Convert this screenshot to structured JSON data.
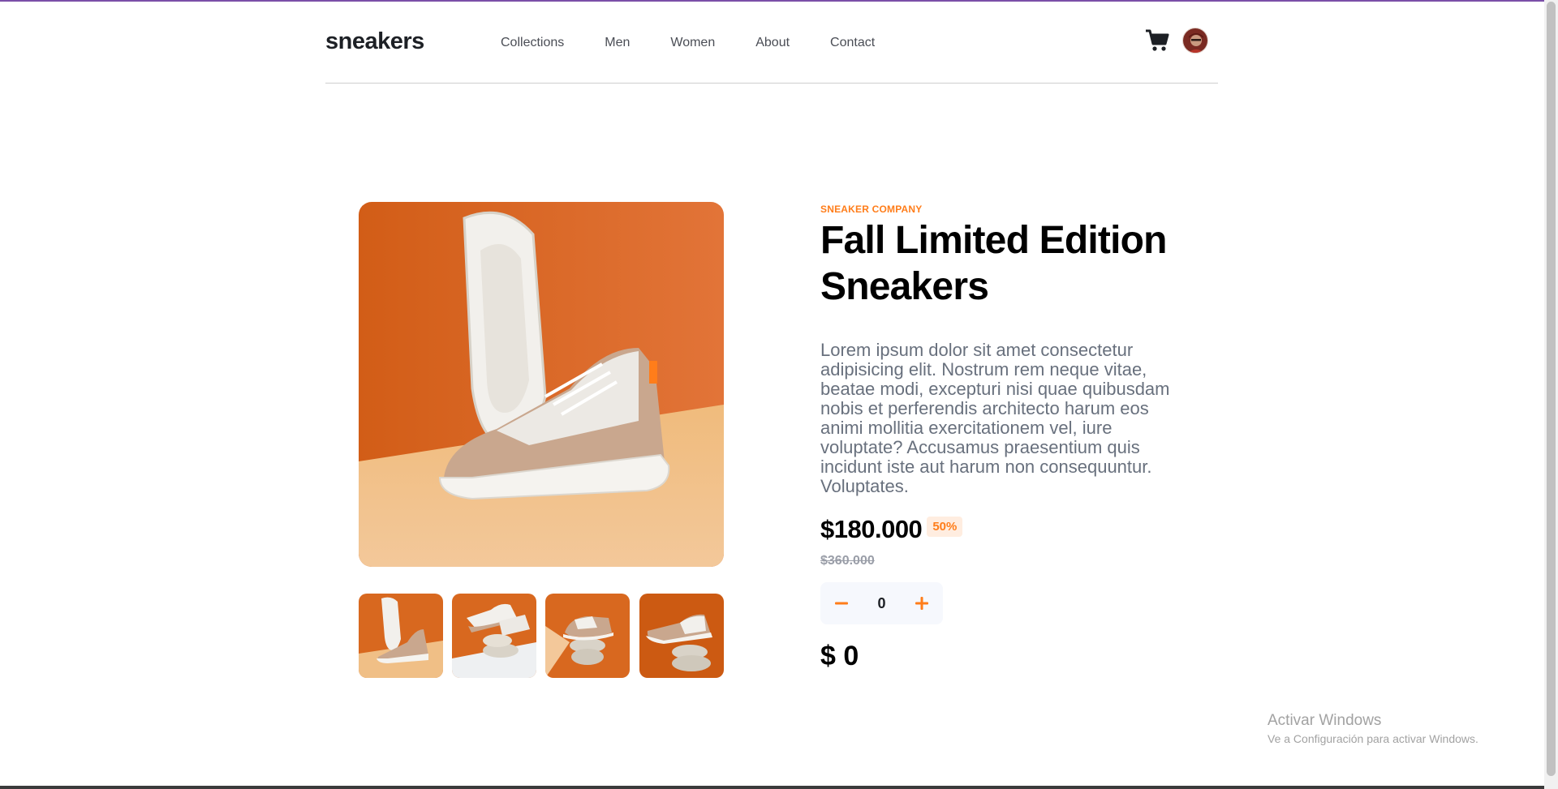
{
  "header": {
    "logo": "sneakers",
    "nav": [
      "Collections",
      "Men",
      "Women",
      "About",
      "Contact"
    ],
    "cart_icon": "cart-icon",
    "avatar_icon": "avatar"
  },
  "gallery": {
    "main_image": "sneaker-product-photo",
    "thumbnails": [
      "thumbnail-1",
      "thumbnail-2",
      "thumbnail-3",
      "thumbnail-4"
    ]
  },
  "product": {
    "company": "SNEAKER COMPANY",
    "title": "Fall Limited Edition Sneakers",
    "description": "Lorem ipsum dolor sit amet consectetur adipisicing elit. Nostrum rem neque vitae, beatae modi, excepturi nisi quae quibusdam nobis et perferendis architecto harum eos animi mollitia exercitationem vel, iure voluptate? Accusamus praesentium quis incidunt iste aut harum non consequuntur. Voluptates.",
    "price": "$180.000",
    "discount": "50%",
    "old_price": "$360.000",
    "quantity": "0",
    "total": "$ 0"
  },
  "watermark": {
    "title": "Activar Windows",
    "subtitle": "Ve a Configuración para activar Windows."
  },
  "colors": {
    "accent": "#ff7d1a",
    "accent_pale": "#ffede0",
    "text_dark": "#1d2025",
    "text_gray": "#68707d"
  }
}
